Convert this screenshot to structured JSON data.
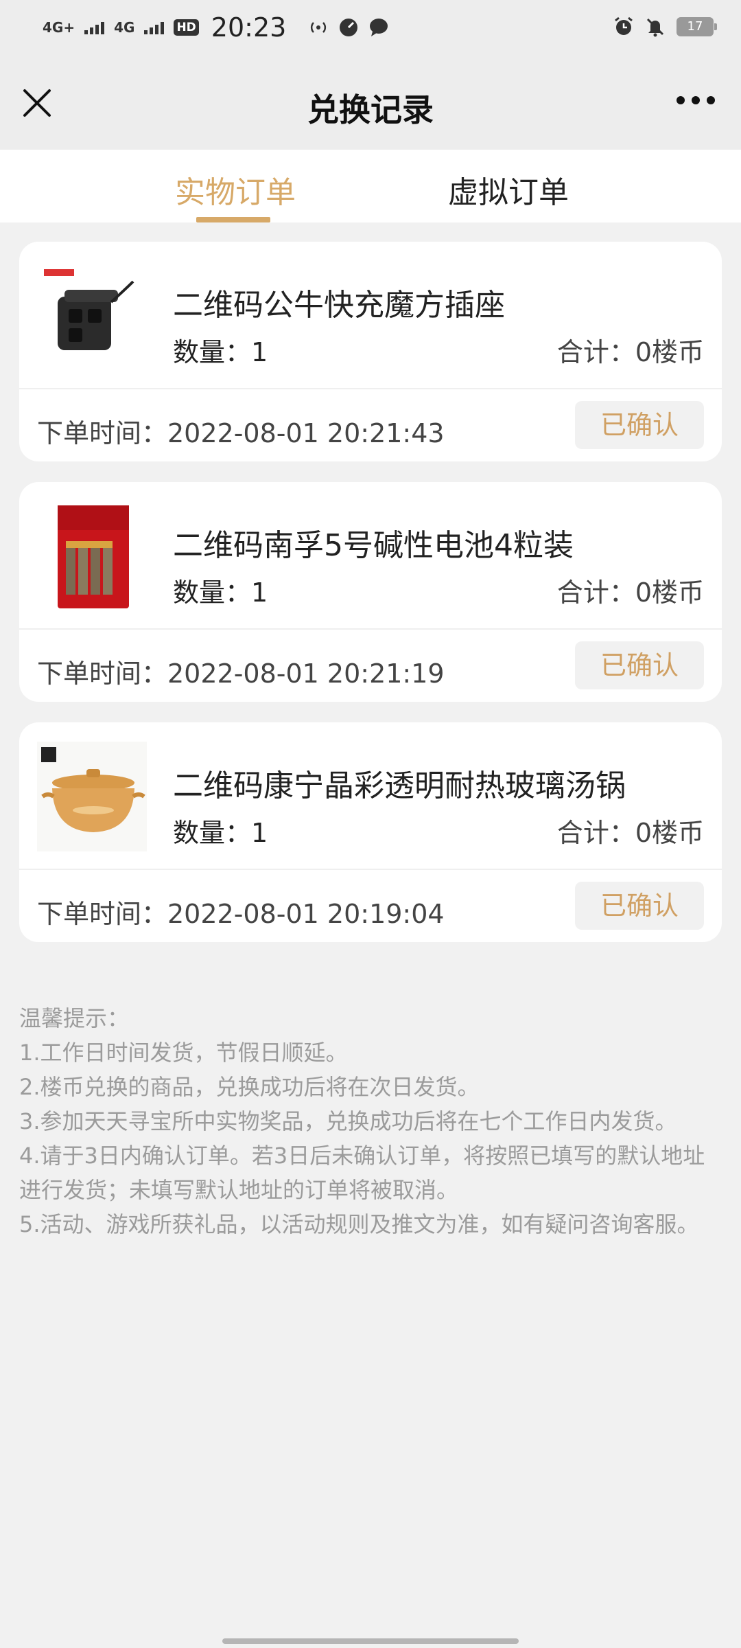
{
  "status_bar": {
    "network_1": "4G+",
    "network_2": "4G",
    "hd_badge": "HD",
    "time": "20:23",
    "battery": "17"
  },
  "nav": {
    "title": "兑换记录",
    "close_icon": "close-icon",
    "more_icon": "more-icon"
  },
  "tabs": [
    {
      "label": "实物订单",
      "active": true
    },
    {
      "label": "虚拟订单",
      "active": false
    }
  ],
  "orders": [
    {
      "name": "二维码公牛快充魔方插座",
      "qty_label": "数量：1",
      "total_label": "合计：0楼币",
      "time_label": "下单时间：2022-08-01 20:21:43",
      "status": "已确认",
      "image": "power-cube-socket"
    },
    {
      "name": "二维码南孚5号碱性电池4粒装",
      "qty_label": "数量：1",
      "total_label": "合计：0楼币",
      "time_label": "下单时间：2022-08-01 20:21:19",
      "status": "已确认",
      "image": "battery-pack"
    },
    {
      "name": "二维码康宁晶彩透明耐热玻璃汤锅",
      "qty_label": "数量：1",
      "total_label": "合计：0楼币",
      "time_label": "下单时间：2022-08-01 20:19:04",
      "status": "已确认",
      "image": "glass-pot"
    }
  ],
  "tips": {
    "title": "温馨提示：",
    "lines": [
      "1.工作日时间发货，节假日顺延。",
      "2.楼币兑换的商品，兑换成功后将在次日发货。",
      "3.参加天天寻宝所中实物奖品，兑换成功后将在七个工作日内发货。",
      "4.请于3日内确认订单。若3日后未确认订单，将按照已填写的默认地址进行发货；未填写默认地址的订单将被取消。",
      "5.活动、游戏所获礼品，以活动规则及推文为准，如有疑问咨询客服。"
    ]
  },
  "colors": {
    "accent": "#d7a968",
    "status_text": "#d0a063",
    "page_bg": "#f1f1f1"
  }
}
